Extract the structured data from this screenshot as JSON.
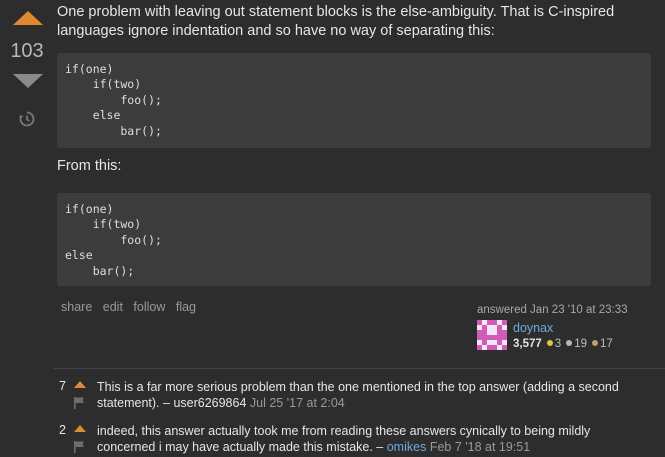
{
  "vote": {
    "count": "103"
  },
  "post": {
    "intro": "One problem with leaving out statement blocks is the else-ambiguity. That is C-inspired languages ignore indentation and so have no way of separating this:",
    "code1": "if(one)\n    if(two)\n        foo();\n    else\n        bar();",
    "between": "From this:",
    "code2": "if(one)\n    if(two)\n        foo();\nelse\n    bar();"
  },
  "menu": {
    "share": "share",
    "edit": "edit",
    "follow": "follow",
    "flag": "flag"
  },
  "signature": {
    "action_time": "answered Jan 23 '10 at 23:33",
    "user": "doynax",
    "reputation": "3,577",
    "gold": "3",
    "silver": "19",
    "bronze": "17"
  },
  "comments": [
    {
      "score": "7",
      "text": "This is a far more serious problem than the one mentioned in the top answer (adding a second statement).",
      "sep": " – ",
      "user": "user6269864",
      "date": "Jul 25 '17 at 2:04"
    },
    {
      "score": "2",
      "text": "indeed, this answer actually took me from reading these answers cynically to being mildly concerned i may have actually made this mistake.",
      "sep": " – ",
      "user": "omikes",
      "date": "Feb 7 '18 at 19:51"
    }
  ],
  "colors": {
    "accent": "#e0892e",
    "link": "#6fa8de",
    "background": "#2d2d2d",
    "code_bg": "#3c3c3c"
  }
}
